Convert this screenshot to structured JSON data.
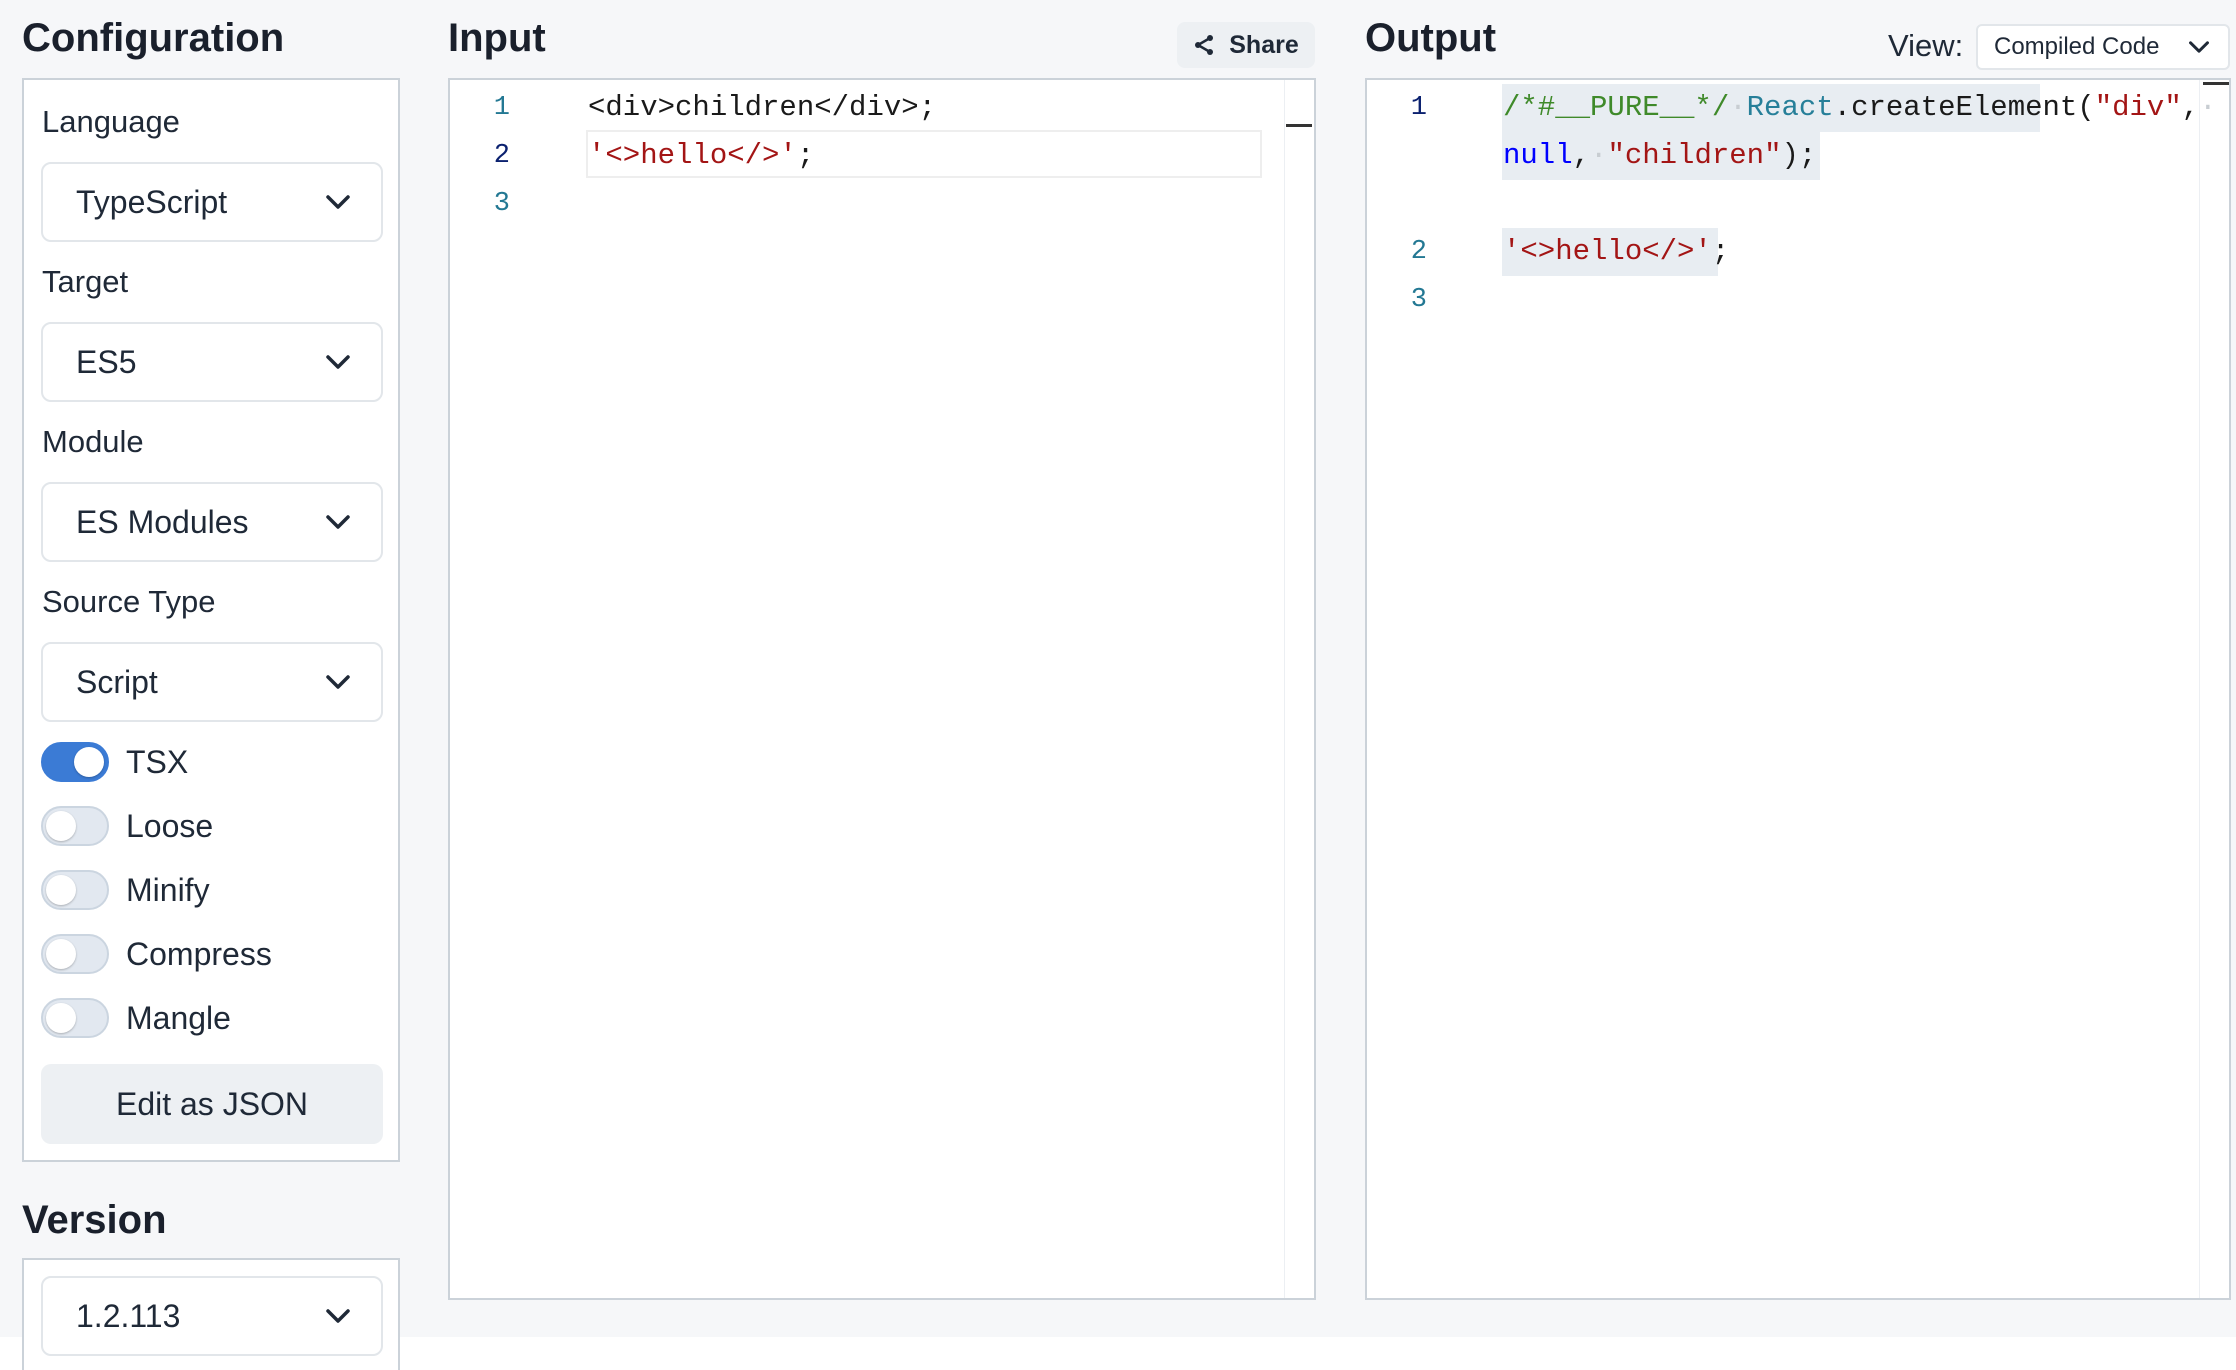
{
  "configuration": {
    "title": "Configuration",
    "language": {
      "label": "Language",
      "value": "TypeScript"
    },
    "target": {
      "label": "Target",
      "value": "ES5"
    },
    "module": {
      "label": "Module",
      "value": "ES Modules"
    },
    "source_type": {
      "label": "Source Type",
      "value": "Script"
    },
    "toggles": [
      {
        "label": "TSX",
        "on": true
      },
      {
        "label": "Loose",
        "on": false
      },
      {
        "label": "Minify",
        "on": false
      },
      {
        "label": "Compress",
        "on": false
      },
      {
        "label": "Mangle",
        "on": false
      }
    ],
    "edit_json_label": "Edit as JSON"
  },
  "version": {
    "title": "Version",
    "value": "1.2.113"
  },
  "input": {
    "title": "Input",
    "share_label": "Share",
    "line_numbers": [
      "1",
      "2",
      "3"
    ],
    "lines": {
      "l1": "<div>children</div>;",
      "l2_str": "'<>hello</>'",
      "l2_end": ";"
    }
  },
  "output": {
    "title": "Output",
    "view_label": "View:",
    "view_value": "Compiled Code",
    "line_numbers": [
      "1",
      "2",
      "3"
    ],
    "lines": {
      "comment": "/*#__PURE__*/",
      "react": "React",
      "create": ".createElement(",
      "div_str": "\"div\"",
      "comma1": ",",
      "null_kw": "null",
      "comma2": ",",
      "children_str": "\"children\"",
      "close": ");",
      "l2_str": "'<>hello</>'",
      "l2_end": ";"
    }
  },
  "colors": {
    "accent": "#3b7bd5",
    "string": "#a31515",
    "comment": "#3f8a2a",
    "type": "#267f99",
    "keyword": "#0000ff",
    "line_number": "#237893"
  }
}
